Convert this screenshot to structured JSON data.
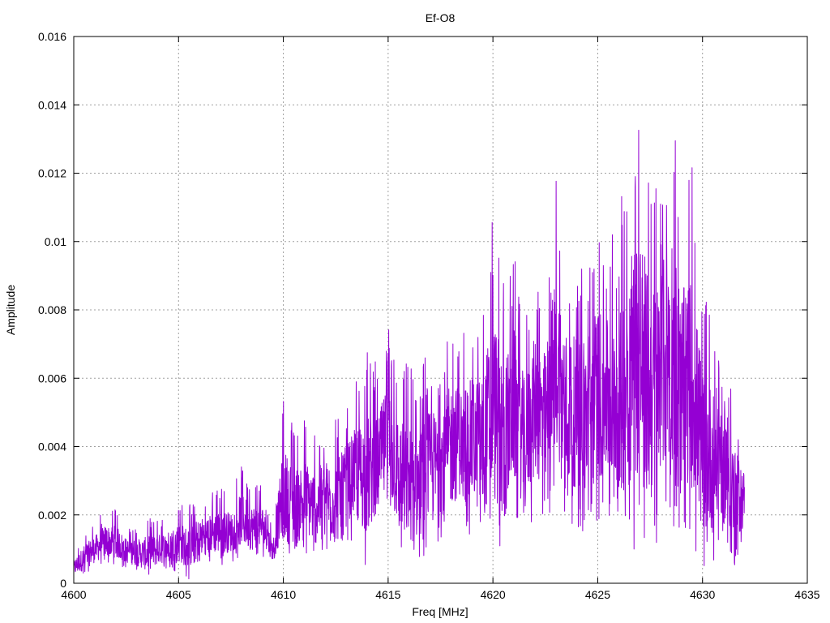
{
  "chart_data": {
    "type": "line",
    "title": "Ef-O8",
    "xlabel": "Freq [MHz]",
    "ylabel": "Amplitude",
    "xlim": [
      4600,
      4635
    ],
    "ylim": [
      0,
      0.016
    ],
    "xticks": [
      4600,
      4605,
      4610,
      4615,
      4620,
      4625,
      4630,
      4635
    ],
    "xtick_labels": [
      "4600",
      "4605",
      "4610",
      "4615",
      "4620",
      "4625",
      "4630",
      "4635"
    ],
    "yticks": [
      0,
      0.002,
      0.004,
      0.006,
      0.008,
      0.01,
      0.012,
      0.014,
      0.016
    ],
    "ytick_labels": [
      "0",
      "0.002",
      "0.004",
      "0.006",
      "0.008",
      "0.01",
      "0.012",
      "0.014",
      "0.016"
    ],
    "grid": true,
    "line_color": "#9400d3",
    "series": [
      {
        "x": [
          4600.0,
          4600.5,
          4601.0,
          4601.5,
          4602.0,
          4602.5,
          4603.0,
          4603.5,
          4604.0,
          4604.5,
          4605.0,
          4605.5,
          4606.0,
          4606.5,
          4607.0,
          4607.5,
          4608.0,
          4608.5,
          4609.0,
          4609.5,
          4610.0,
          4610.5,
          4611.0,
          4611.5,
          4612.0,
          4612.5,
          4613.0,
          4613.5,
          4614.0,
          4614.5,
          4615.0,
          4615.5,
          4616.0,
          4616.5,
          4617.0,
          4617.5,
          4618.0,
          4618.5,
          4619.0,
          4619.5,
          4620.0,
          4620.5,
          4621.0,
          4621.5,
          4622.0,
          4622.5,
          4623.0,
          4623.5,
          4624.0,
          4624.5,
          4625.0,
          4625.5,
          4626.0,
          4626.5,
          4627.0,
          4627.5,
          4628.0,
          4628.5,
          4629.0,
          4629.5,
          4630.0,
          4630.5,
          4631.0,
          4631.5,
          4632.0
        ],
        "y": [
          0.0003,
          0.0007,
          0.001,
          0.0013,
          0.0016,
          0.0012,
          0.001,
          0.0012,
          0.001,
          0.0011,
          0.0013,
          0.0014,
          0.0012,
          0.0015,
          0.0016,
          0.0018,
          0.0019,
          0.002,
          0.0021,
          0.0009,
          0.003,
          0.0026,
          0.0027,
          0.0026,
          0.0027,
          0.0031,
          0.003,
          0.0038,
          0.0043,
          0.0042,
          0.004,
          0.0038,
          0.0033,
          0.0039,
          0.0034,
          0.0038,
          0.0041,
          0.0039,
          0.0045,
          0.0046,
          0.0049,
          0.0047,
          0.005,
          0.0048,
          0.005,
          0.0049,
          0.0053,
          0.0051,
          0.005,
          0.0052,
          0.0056,
          0.0055,
          0.0057,
          0.0058,
          0.0062,
          0.0063,
          0.006,
          0.0058,
          0.0052,
          0.005,
          0.0046,
          0.004,
          0.003,
          0.002,
          0.0015
        ],
        "peak_y": [
          0.0009,
          0.0015,
          0.0018,
          0.0022,
          0.0022,
          0.0017,
          0.0017,
          0.0019,
          0.0019,
          0.002,
          0.0024,
          0.0023,
          0.0025,
          0.0026,
          0.0029,
          0.0027,
          0.0035,
          0.003,
          0.0029,
          0.0015,
          0.0054,
          0.0047,
          0.0048,
          0.0045,
          0.0047,
          0.0049,
          0.0052,
          0.0061,
          0.0068,
          0.0064,
          0.0077,
          0.0066,
          0.0064,
          0.0063,
          0.007,
          0.0066,
          0.0079,
          0.0074,
          0.008,
          0.0083,
          0.011,
          0.009,
          0.01,
          0.008,
          0.0095,
          0.009,
          0.012,
          0.01,
          0.0095,
          0.01,
          0.011,
          0.0102,
          0.0105,
          0.0135,
          0.0149,
          0.012,
          0.0124,
          0.0143,
          0.0117,
          0.0123,
          0.0088,
          0.008,
          0.0078,
          0.0055,
          0.0042
        ],
        "trough_y": [
          0.0001,
          0.0002,
          0.0004,
          0.0005,
          0.0005,
          0.0004,
          0.0003,
          0.0001,
          0.0003,
          0.0004,
          0.0003,
          0.0001,
          0.0005,
          0.0006,
          0.0005,
          0.0006,
          0.0007,
          0.0006,
          0.0008,
          0.0005,
          0.0007,
          0.0002,
          0.0009,
          0.0005,
          0.001,
          0.0004,
          0.0013,
          0.0011,
          0.0004,
          0.0013,
          0.0016,
          0.0007,
          0.0003,
          0.0004,
          0.0006,
          0.0013,
          0.0012,
          0.0018,
          0.0013,
          0.0008,
          0.001,
          0.0003,
          0.0017,
          0.0012,
          0.002,
          0.0015,
          0.0026,
          0.0014,
          0.0017,
          0.001,
          0.0016,
          0.0017,
          0.0012,
          0.0009,
          0.0011,
          0.0005,
          0.0014,
          0.0018,
          0.0013,
          0.0011,
          0.0005,
          0.0003,
          0.001,
          0.0004,
          0.0012
        ]
      }
    ]
  }
}
